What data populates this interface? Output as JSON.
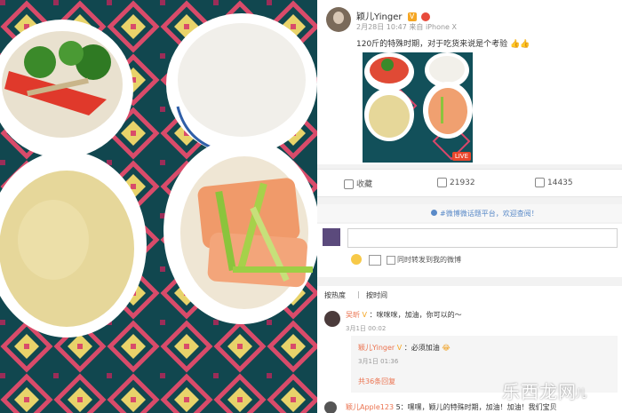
{
  "post": {
    "username": "颖儿Yinger",
    "meta": "2月28日 10:47 来自 iPhone X",
    "text": "120斤的特殊时期，对于吃货来说是个考验",
    "live_badge": "LIVE"
  },
  "actions": {
    "share_label": "收藏",
    "repost_count": "21932",
    "comment_count": "14435"
  },
  "notice": {
    "text": "#微博微话题平台，欢迎查阅！"
  },
  "compose": {
    "sync_label": "同时转发到我的微博"
  },
  "sort": {
    "hot_label": "按热度",
    "time_label": "按时间"
  },
  "comments": [
    {
      "name": "吴昕",
      "text": "：咪咪咪，加油，你可以的～",
      "time": "3月1日 00:02"
    },
    {
      "name": "颖儿Yinger",
      "text": "：必须加油",
      "time": "3月1日 01:36"
    }
  ],
  "more_replies": "共36条回复",
  "last_comment": {
    "name": "颖儿Apple123",
    "text": "5：嘿嘿，颖儿的特殊时期，加油！加油！我们宝贝",
    "extra": "特殊时期"
  },
  "watermark": {
    "main": "乐西龙网",
    "sub": "儿"
  },
  "colors": {
    "accent": "#eb7350",
    "link": "#5a8ac8"
  }
}
